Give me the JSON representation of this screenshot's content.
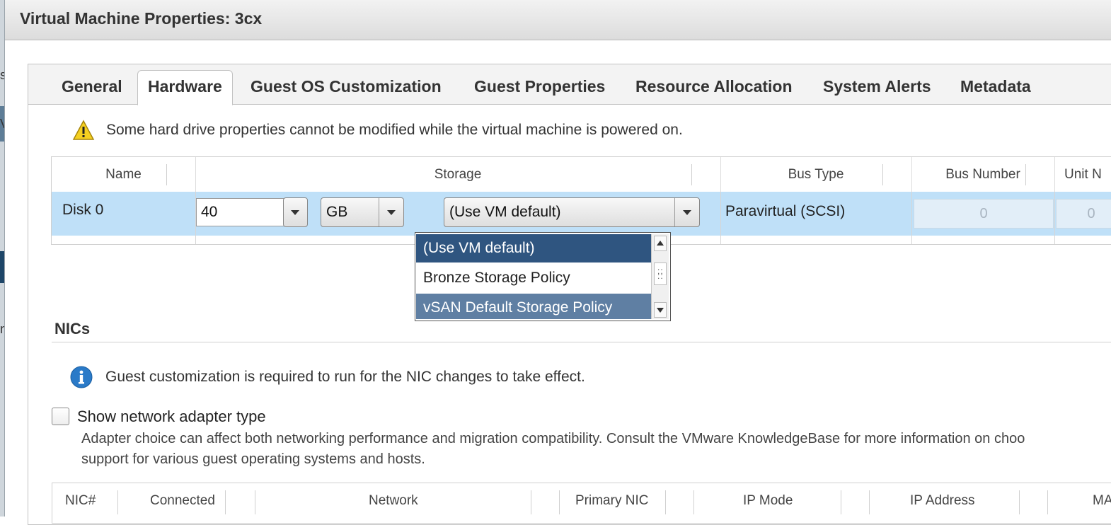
{
  "background_fragments": [
    "s",
    "V",
    "n"
  ],
  "window": {
    "title": "Virtual Machine Properties: 3cx"
  },
  "tabs": [
    {
      "label": "General",
      "active": false
    },
    {
      "label": "Hardware",
      "active": true
    },
    {
      "label": "Guest OS Customization",
      "active": false
    },
    {
      "label": "Guest Properties",
      "active": false
    },
    {
      "label": "Resource Allocation",
      "active": false
    },
    {
      "label": "System Alerts",
      "active": false
    },
    {
      "label": "Metadata",
      "active": false
    }
  ],
  "hard_disks": {
    "warning": "Some hard drive properties cannot be modified while the virtual machine is powered on.",
    "columns": [
      "Name",
      "Storage",
      "Bus Type",
      "Bus Number",
      "Unit N"
    ],
    "row": {
      "name": "Disk 0",
      "size_value": "40",
      "size_unit": "GB",
      "storage_policy": "(Use VM default)",
      "bus_type": "Paravirtual (SCSI)",
      "bus_number": "0",
      "unit_number": "0"
    },
    "policy_dropdown": {
      "options": [
        "(Use VM default)",
        "Bronze Storage Policy",
        "vSAN Default Storage Policy"
      ],
      "selected": "(Use VM default)",
      "highlighted": "vSAN Default Storage Policy"
    }
  },
  "nics": {
    "title": "NICs",
    "info": "Guest customization is required to run for the NIC changes to take effect.",
    "show_adapter_checkbox": {
      "label": "Show network adapter type",
      "checked": false
    },
    "help_line1": "Adapter choice can affect both networking performance and migration compatibility. Consult the VMware KnowledgeBase for more information on choo",
    "help_line2": "support for various guest operating systems and hosts.",
    "columns": [
      "NIC#",
      "Connected",
      "Network",
      "Primary NIC",
      "IP Mode",
      "IP Address",
      "MA"
    ]
  },
  "colors": {
    "selected_row": "#bfe0f8",
    "dropdown_selected": "#2f5580",
    "dropdown_hover": "#5f7fa3",
    "warning_yellow": "#f5d020",
    "info_blue": "#2a7ac8"
  }
}
